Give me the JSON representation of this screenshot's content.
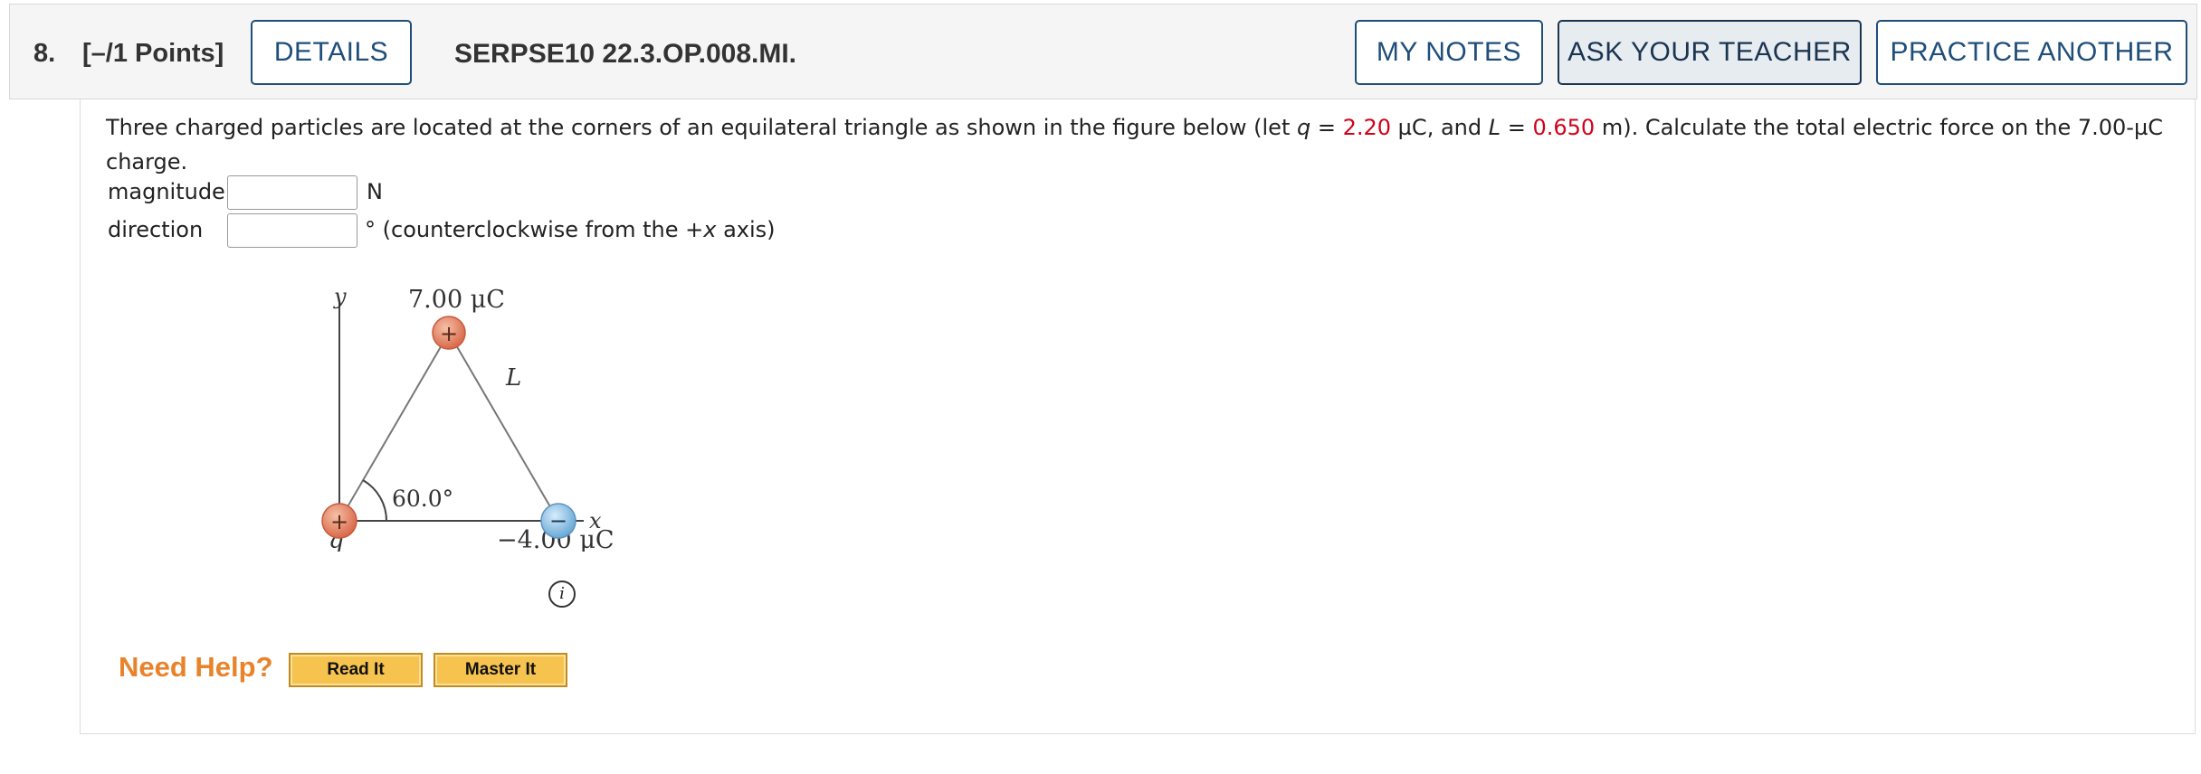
{
  "header": {
    "number": "8.",
    "points": "[–/1 Points]",
    "details_label": "DETAILS",
    "code": "SERPSE10 22.3.OP.008.MI.",
    "notes_label": "MY NOTES",
    "ask_label": "ASK YOUR TEACHER",
    "practice_label": "PRACTICE ANOTHER"
  },
  "question": {
    "text_1": "Three charged particles are located at the corners of an equilateral triangle as shown in the figure below (let ",
    "q_var": "q",
    "eq": " = ",
    "q_value": "2.20",
    "text_2": " µC, and ",
    "l_var": "L",
    "l_value": "0.650",
    "text_3": " m). Calculate the total electric force on the 7.00-µC charge."
  },
  "answers": {
    "magnitude_label": "magnitude",
    "magnitude_value": "",
    "magnitude_unit": "N",
    "direction_label": "direction",
    "direction_value": "",
    "direction_unit_prefix": "° (counterclockwise from the +",
    "direction_unit_var": "x",
    "direction_unit_suffix": " axis)"
  },
  "figure": {
    "y_axis": "y",
    "x_axis": "x",
    "top_charge": "7.00 μC",
    "side_label": "L",
    "angle": "60.0°",
    "left_charge": "q",
    "right_charge": "−4.00 μC",
    "info": "i",
    "colors": {
      "positive": "#e07a5f",
      "negative": "#7fb5db"
    }
  },
  "help": {
    "label": "Need Help?",
    "read_label": "Read It",
    "master_label": "Master It"
  }
}
